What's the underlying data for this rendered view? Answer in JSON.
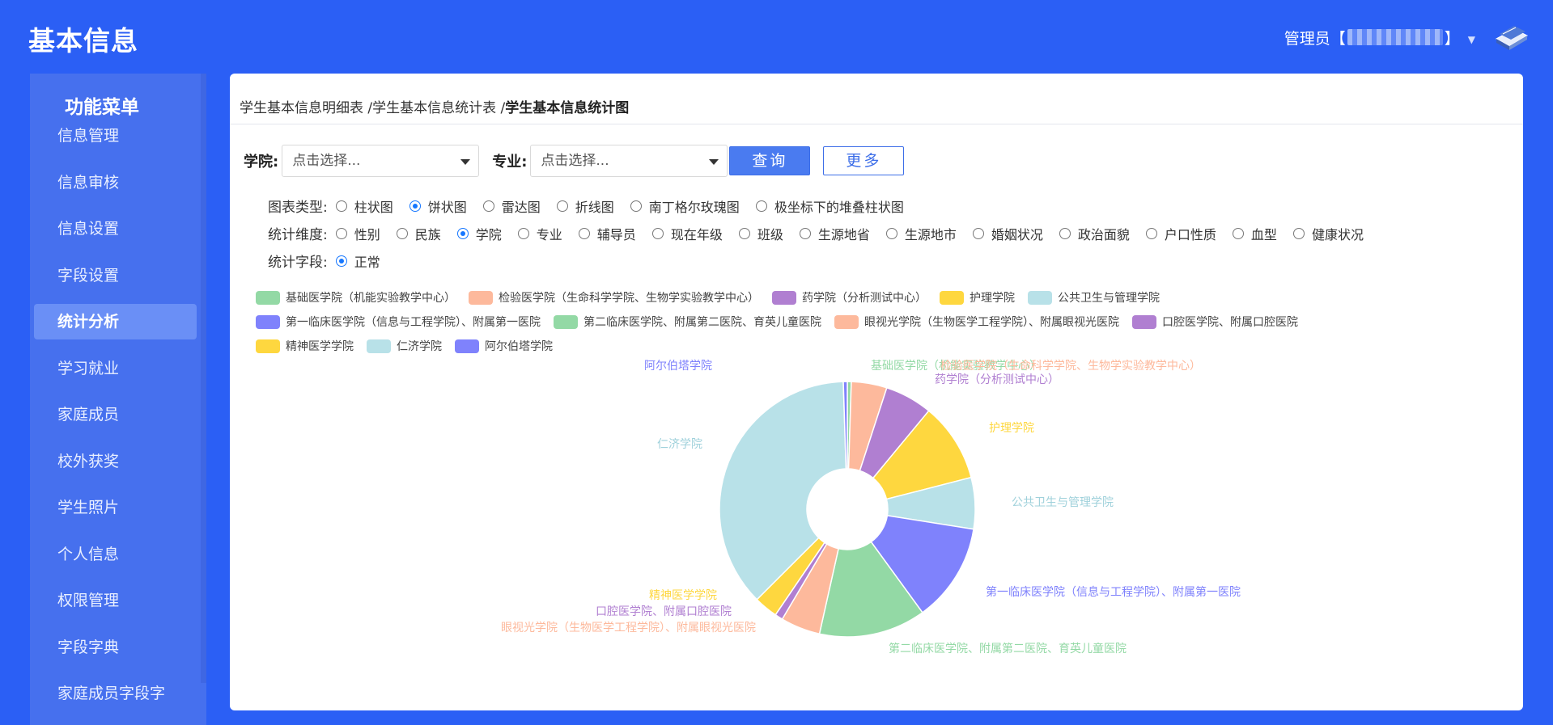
{
  "header": {
    "app_title": "基本信息",
    "user_label": "管理员【",
    "user_tail": "】"
  },
  "sidebar": {
    "title": "功能菜单",
    "items": [
      {
        "label": "信息管理",
        "name": "sidebar-item-info-manage",
        "active": false
      },
      {
        "label": "信息审核",
        "name": "sidebar-item-info-review",
        "active": false
      },
      {
        "label": "信息设置",
        "name": "sidebar-item-info-settings",
        "active": false
      },
      {
        "label": "字段设置",
        "name": "sidebar-item-field-settings",
        "active": false
      },
      {
        "label": "统计分析",
        "name": "sidebar-item-statistics",
        "active": true
      },
      {
        "label": "学习就业",
        "name": "sidebar-item-study-employment",
        "active": false
      },
      {
        "label": "家庭成员",
        "name": "sidebar-item-family-members",
        "active": false
      },
      {
        "label": "校外获奖",
        "name": "sidebar-item-external-awards",
        "active": false
      },
      {
        "label": "学生照片",
        "name": "sidebar-item-student-photos",
        "active": false
      },
      {
        "label": "个人信息",
        "name": "sidebar-item-personal-info",
        "active": false
      },
      {
        "label": "权限管理",
        "name": "sidebar-item-permissions",
        "active": false
      },
      {
        "label": "字段字典",
        "name": "sidebar-item-field-dictionary",
        "active": false
      },
      {
        "label": "家庭成员字段字",
        "name": "sidebar-item-family-field-dict",
        "active": false
      }
    ]
  },
  "breadcrumb": {
    "part1": "学生基本信息明细表 /",
    "part2": "学生基本信息统计表 /",
    "current": "学生基本信息统计图"
  },
  "filters": {
    "college_label": "学院:",
    "college_placeholder": "点击选择...",
    "major_label": "专业:",
    "major_placeholder": "点击选择...",
    "query_button": "查询",
    "more_button": "更多"
  },
  "chart_type_row": {
    "label": "图表类型:",
    "options": [
      "柱状图",
      "饼状图",
      "雷达图",
      "折线图",
      "南丁格尔玫瑰图",
      "极坐标下的堆叠柱状图"
    ],
    "selected": 1
  },
  "dimension_row": {
    "label": "统计维度:",
    "options": [
      "性别",
      "民族",
      "学院",
      "专业",
      "辅导员",
      "现在年级",
      "班级",
      "生源地省",
      "生源地市",
      "婚姻状况",
      "政治面貌",
      "户口性质",
      "血型",
      "健康状况"
    ],
    "selected": 2
  },
  "field_row": {
    "label": "统计字段:",
    "options": [
      "正常"
    ],
    "selected": 0
  },
  "colors": {
    "background": "#2b5ff5",
    "sidebar": "#4670ee",
    "sidebar_active": "#6a8ff6",
    "primary": "#4a7bf0"
  },
  "chart_data": {
    "type": "pie",
    "donut": true,
    "legend_placement": "top",
    "slices": [
      {
        "label": "基础医学院（机能实验教学中心）",
        "value": 0.5,
        "color": "#93d9a5"
      },
      {
        "label": "检验医学院（生命科学学院、生物学实验教学中心）",
        "value": 4.5,
        "color": "#fdb99c"
      },
      {
        "label": "药学院（分析测试中心）",
        "value": 6,
        "color": "#b07fd1"
      },
      {
        "label": "护理学院",
        "value": 10,
        "color": "#fed73f"
      },
      {
        "label": "公共卫生与管理学院",
        "value": 6.5,
        "color": "#b8e1e8"
      },
      {
        "label": "第一临床医学院（信息与工程学院）、附属第一医院",
        "value": 12.5,
        "color": "#7f82fc"
      },
      {
        "label": "第二临床医学院、附属第二医院、育英儿童医院",
        "value": 13.5,
        "color": "#93d9a5"
      },
      {
        "label": "眼视光学院（生物医学工程学院）、附属眼视光医院",
        "value": 5,
        "color": "#fdb99c"
      },
      {
        "label": "口腔医学院、附属口腔医院",
        "value": 1,
        "color": "#b07fd1"
      },
      {
        "label": "精神医学学院",
        "value": 3,
        "color": "#fed73f"
      },
      {
        "label": "仁济学院",
        "value": 37,
        "color": "#b8e1e8"
      },
      {
        "label": "阿尔伯塔学院",
        "value": 0.5,
        "color": "#7f82fc"
      }
    ]
  }
}
